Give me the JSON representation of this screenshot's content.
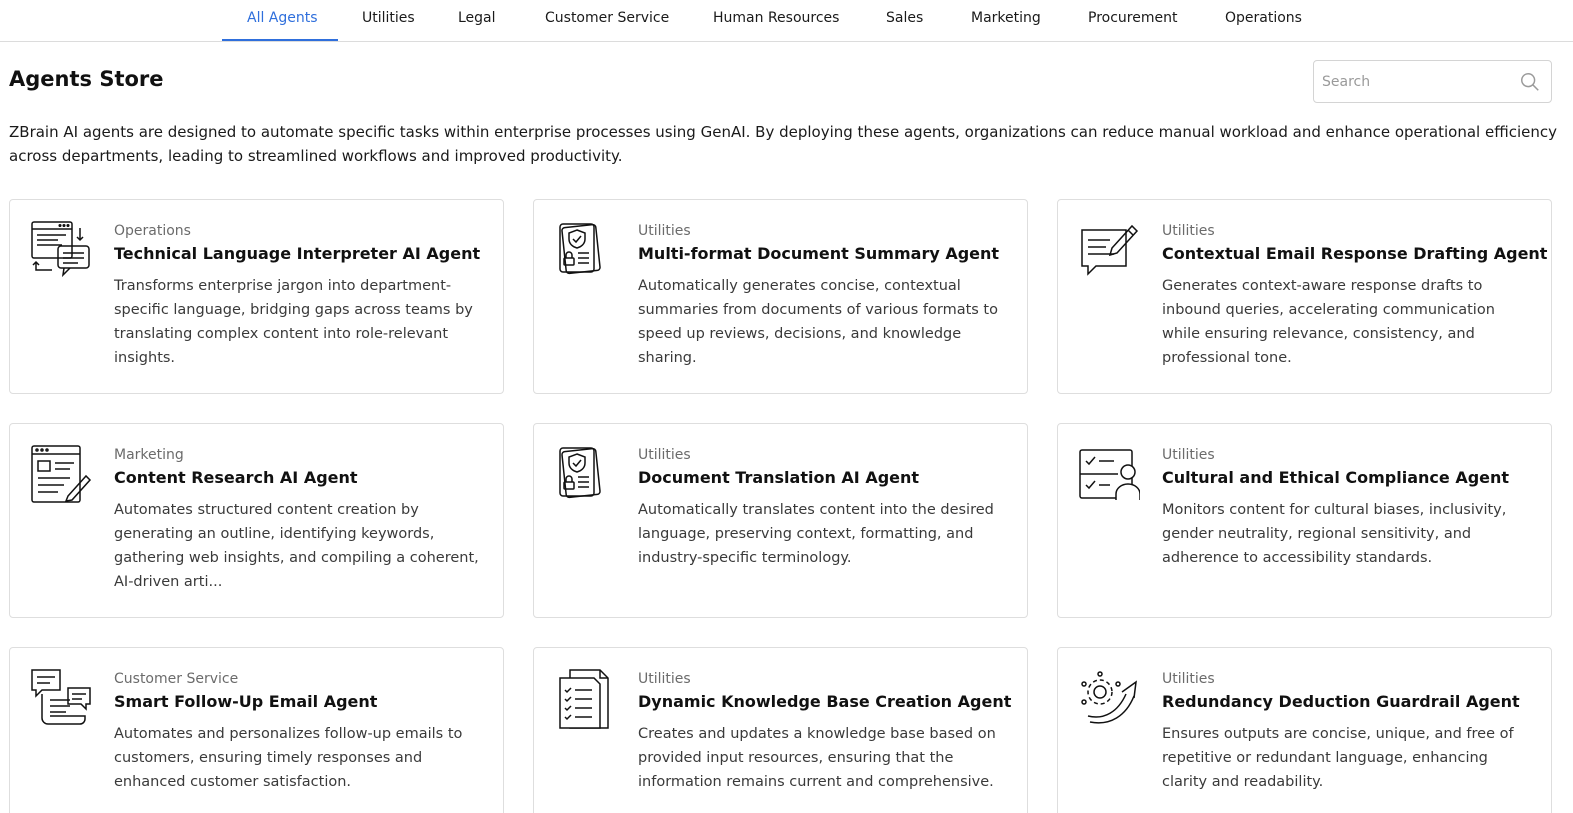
{
  "tabs": [
    {
      "label": "All Agents",
      "active": true
    },
    {
      "label": "Utilities"
    },
    {
      "label": "Legal"
    },
    {
      "label": "Customer Service"
    },
    {
      "label": "Human Resources"
    },
    {
      "label": "Sales"
    },
    {
      "label": "Marketing"
    },
    {
      "label": "Procurement"
    },
    {
      "label": "Operations"
    }
  ],
  "page": {
    "title": "Agents Store",
    "search_placeholder": "Search",
    "intro": "ZBrain AI agents are designed to automate specific tasks within enterprise processes using GenAI. By deploying these agents, organizations can reduce manual workload and enhance operational efficiency across departments, leading to streamlined workflows and improved productivity."
  },
  "colors": {
    "accent": "#2f6fdc",
    "border": "#dedede",
    "muted": "#6b6b6b"
  },
  "cards": [
    {
      "category": "Operations",
      "title": "Technical Language Interpreter AI Agent",
      "description": "Transforms enterprise jargon into department-specific language, bridging gaps across teams by translating complex content into role-relevant insights.",
      "icon": "document-chat-icon"
    },
    {
      "category": "Utilities",
      "title": "Multi-format Document Summary Agent",
      "description": "Automatically generates concise, contextual summaries from documents of various formats to speed up reviews, decisions, and knowledge sharing.",
      "icon": "shield-document-icon"
    },
    {
      "category": "Utilities",
      "title": "Contextual Email Response Drafting Agent",
      "description": "Generates context-aware response drafts to inbound queries, accelerating communication while ensuring relevance, consistency, and professional tone.",
      "icon": "message-edit-icon"
    },
    {
      "category": "Marketing",
      "title": "Content Research AI Agent",
      "description": "Automates structured content creation by generating an outline, identifying keywords, gathering web insights, and compiling a coherent, AI-driven arti...",
      "icon": "browser-edit-icon"
    },
    {
      "category": "Utilities",
      "title": "Document Translation AI Agent",
      "description": "Automatically translates content into the desired language, preserving context, formatting, and industry-specific terminology.",
      "icon": "shield-document-icon"
    },
    {
      "category": "Utilities",
      "title": "Cultural and Ethical Compliance Agent",
      "description": "Monitors content for cultural biases, inclusivity, gender neutrality, regional sensitivity, and adherence to accessibility standards.",
      "icon": "checklist-user-icon"
    },
    {
      "category": "Customer Service",
      "title": "Smart Follow-Up Email Agent",
      "description": "Automates and personalizes follow-up emails to customers, ensuring timely responses and enhanced customer satisfaction.",
      "icon": "chat-scroll-icon"
    },
    {
      "category": "Utilities",
      "title": "Dynamic Knowledge Base Creation Agent",
      "description": "Creates and updates a knowledge base based on provided input resources, ensuring that the information remains current and comprehensive.",
      "icon": "checklist-docs-icon"
    },
    {
      "category": "Utilities",
      "title": "Redundancy Deduction Guardrail Agent",
      "description": "Ensures outputs are concise, unique, and free of repetitive or redundant language, enhancing clarity and readability.",
      "icon": "gear-arrow-icon"
    }
  ]
}
